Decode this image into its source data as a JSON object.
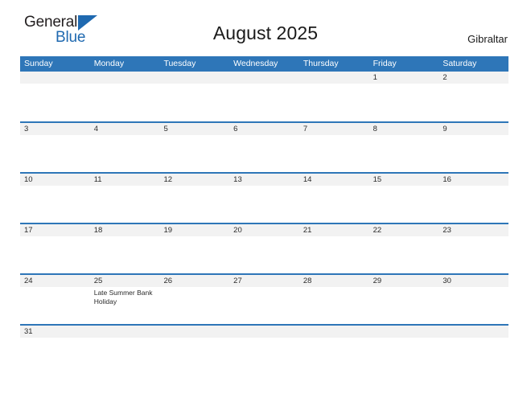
{
  "brand": {
    "name_part1": "General",
    "name_part2": "Blue",
    "triangle_icon": "blue-triangle-icon",
    "color_dark": "#231f20",
    "color_blue": "#1f69b0"
  },
  "header": {
    "title": "August 2025",
    "location": "Gibraltar"
  },
  "theme": {
    "accent": "#2e76b8",
    "band": "#f2f2f2",
    "text": "#2b2b2b"
  },
  "calendar": {
    "weekdays": [
      "Sunday",
      "Monday",
      "Tuesday",
      "Wednesday",
      "Thursday",
      "Friday",
      "Saturday"
    ],
    "weeks": [
      [
        {
          "date": "",
          "event": ""
        },
        {
          "date": "",
          "event": ""
        },
        {
          "date": "",
          "event": ""
        },
        {
          "date": "",
          "event": ""
        },
        {
          "date": "",
          "event": ""
        },
        {
          "date": "1",
          "event": ""
        },
        {
          "date": "2",
          "event": ""
        }
      ],
      [
        {
          "date": "3",
          "event": ""
        },
        {
          "date": "4",
          "event": ""
        },
        {
          "date": "5",
          "event": ""
        },
        {
          "date": "6",
          "event": ""
        },
        {
          "date": "7",
          "event": ""
        },
        {
          "date": "8",
          "event": ""
        },
        {
          "date": "9",
          "event": ""
        }
      ],
      [
        {
          "date": "10",
          "event": ""
        },
        {
          "date": "11",
          "event": ""
        },
        {
          "date": "12",
          "event": ""
        },
        {
          "date": "13",
          "event": ""
        },
        {
          "date": "14",
          "event": ""
        },
        {
          "date": "15",
          "event": ""
        },
        {
          "date": "16",
          "event": ""
        }
      ],
      [
        {
          "date": "17",
          "event": ""
        },
        {
          "date": "18",
          "event": ""
        },
        {
          "date": "19",
          "event": ""
        },
        {
          "date": "20",
          "event": ""
        },
        {
          "date": "21",
          "event": ""
        },
        {
          "date": "22",
          "event": ""
        },
        {
          "date": "23",
          "event": ""
        }
      ],
      [
        {
          "date": "24",
          "event": ""
        },
        {
          "date": "25",
          "event": "Late Summer Bank Holiday"
        },
        {
          "date": "26",
          "event": ""
        },
        {
          "date": "27",
          "event": ""
        },
        {
          "date": "28",
          "event": ""
        },
        {
          "date": "29",
          "event": ""
        },
        {
          "date": "30",
          "event": ""
        }
      ],
      [
        {
          "date": "31",
          "event": ""
        },
        {
          "date": "",
          "event": ""
        },
        {
          "date": "",
          "event": ""
        },
        {
          "date": "",
          "event": ""
        },
        {
          "date": "",
          "event": ""
        },
        {
          "date": "",
          "event": ""
        },
        {
          "date": "",
          "event": ""
        }
      ]
    ]
  }
}
